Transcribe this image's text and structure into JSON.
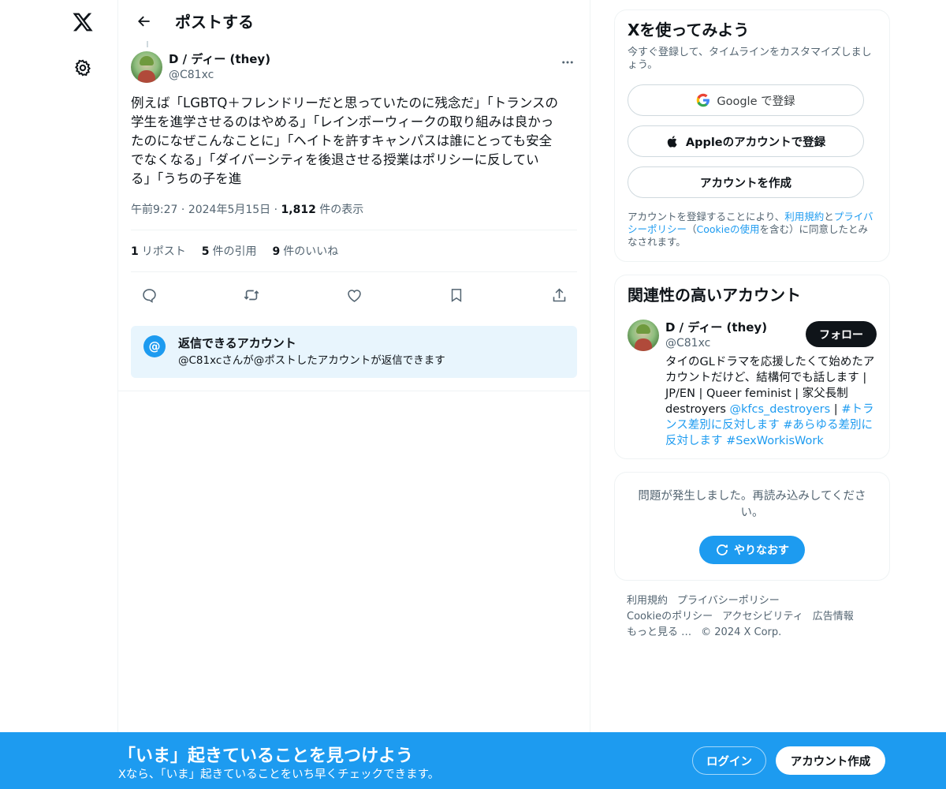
{
  "header": {
    "title": "ポストする"
  },
  "post": {
    "author_name": "D / ディー (they)",
    "author_handle": "@C81xc",
    "text": "例えば「LGBTQ＋フレンドリーだと思っていたのに残念だ」「トランスの\n学生を進学させるのはやめる」「レインボーウィークの取り組みは良かっ\nたのになぜこんなことに」「ヘイトを許すキャンパスは誰にとっても安全\nでなくなる」「ダイバーシティを後退させる授業はポリシーに反してい\nる」「うちの子を進",
    "time": "午前9:27",
    "date": "2024年5月15日",
    "views_count": "1,812",
    "views_label": "件の表示",
    "stats": {
      "reposts_count": "1",
      "reposts_label": "リポスト",
      "quotes_count": "5",
      "quotes_label": "件の引用",
      "likes_count": "9",
      "likes_label": "件のいいね"
    },
    "reply_restriction": {
      "title": "返信できるアカウント",
      "description": "@C81xcさんが@ポストしたアカウントが返信できます"
    }
  },
  "signup": {
    "heading": "Xを使ってみよう",
    "subtitle": "今すぐ登録して、タイムラインをカスタマイズしましょう。",
    "google_label": "Google で登録",
    "apple_label": "Appleのアカウントで登録",
    "create_label": "アカウントを作成",
    "legal_prefix": "アカウントを登録することにより、",
    "legal_terms": "利用規約",
    "legal_and": "と",
    "legal_privacy": "プライバシーポリシー",
    "legal_paren_open": "（",
    "legal_cookie": "Cookieの使用",
    "legal_suffix": "を含む）に同意したとみなされます。"
  },
  "related": {
    "heading": "関連性の高いアカウント",
    "name": "D / ディー (they)",
    "handle": "@C81xc",
    "follow_label": "フォロー",
    "bio_text": "タイのGLドラマを応援したくて始めたアカウントだけど、結構何でも話します | JP/EN | Queer feminist | 家父長制destroyers ",
    "bio_mention": "@kfcs_destroyers",
    "bio_sep": " | ",
    "bio_tag1": "#トランス差別に反対します",
    "bio_tag2": "#あらゆる差別に反対します",
    "bio_tag3": "#SexWorkisWork"
  },
  "error": {
    "message": "問題が発生しました。再読み込みしてください。",
    "retry_label": "やりなおす"
  },
  "footer": {
    "terms": "利用規約",
    "privacy": "プライバシーポリシー",
    "cookie": "Cookieのポリシー",
    "accessibility": "アクセシビリティ",
    "ads": "広告情報",
    "more": "もっと見る …",
    "copyright": "© 2024 X Corp."
  },
  "bottom_bar": {
    "title": "「いま」起きていることを見つけよう",
    "subtitle": "Xなら、「いま」起きていることをいち早くチェックできます。",
    "login_label": "ログイン",
    "signup_label": "アカウント作成"
  },
  "colors": {
    "accent": "#1d9bf0",
    "text": "#0f1419",
    "secondary": "#536471",
    "border": "#eff3f4"
  }
}
